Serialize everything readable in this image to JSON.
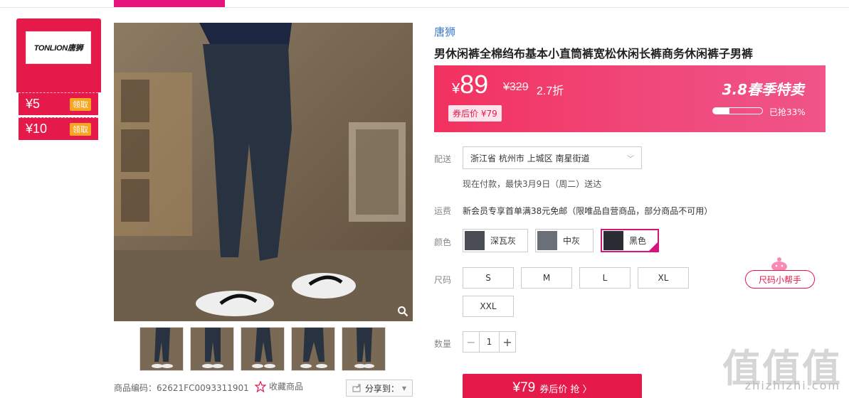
{
  "brand_card": {
    "logo_text": "TONLION唐狮",
    "coupons": [
      {
        "amount": "¥5",
        "action": "领取"
      },
      {
        "amount": "¥10",
        "action": "领取"
      }
    ]
  },
  "product": {
    "brand": "唐狮",
    "title": "男休闲裤全棉绉布基本小直筒裤宽松休闲长裤商务休闲裤子男裤",
    "code": "商品编码：62621FC0093311901",
    "favorite": "收藏商品",
    "share": "分享到："
  },
  "price": {
    "symbol": "¥",
    "current": "89",
    "original": "¥329",
    "discount": "2.7折",
    "after_coupon": "券后价 ¥79",
    "promo": "3.8春季特卖",
    "sold_label": "已抢33%",
    "sold_percent": 33
  },
  "delivery": {
    "label": "配送",
    "address": "浙江省 杭州市 上城区 南星街道",
    "eta": "现在付款，最快3月9日（周二）送达"
  },
  "shipping": {
    "label": "运费",
    "text": "新会员专享首单满38元免邮（限唯品自营商品，部分商品不可用）"
  },
  "color": {
    "label": "颜色",
    "options": [
      "深瓦灰",
      "中灰",
      "黑色"
    ],
    "selected": "黑色"
  },
  "size": {
    "label": "尺码",
    "options": [
      "S",
      "M",
      "L",
      "XL",
      "XXL"
    ],
    "helper": "尺码小帮手"
  },
  "quantity": {
    "label": "数量",
    "value": "1",
    "minus": "−",
    "plus": "+"
  },
  "buy_button": {
    "price": "¥79",
    "text": "券后价 抢 〉"
  },
  "watermark": {
    "text": "值值值",
    "domain": "zhizhizhi.com"
  }
}
